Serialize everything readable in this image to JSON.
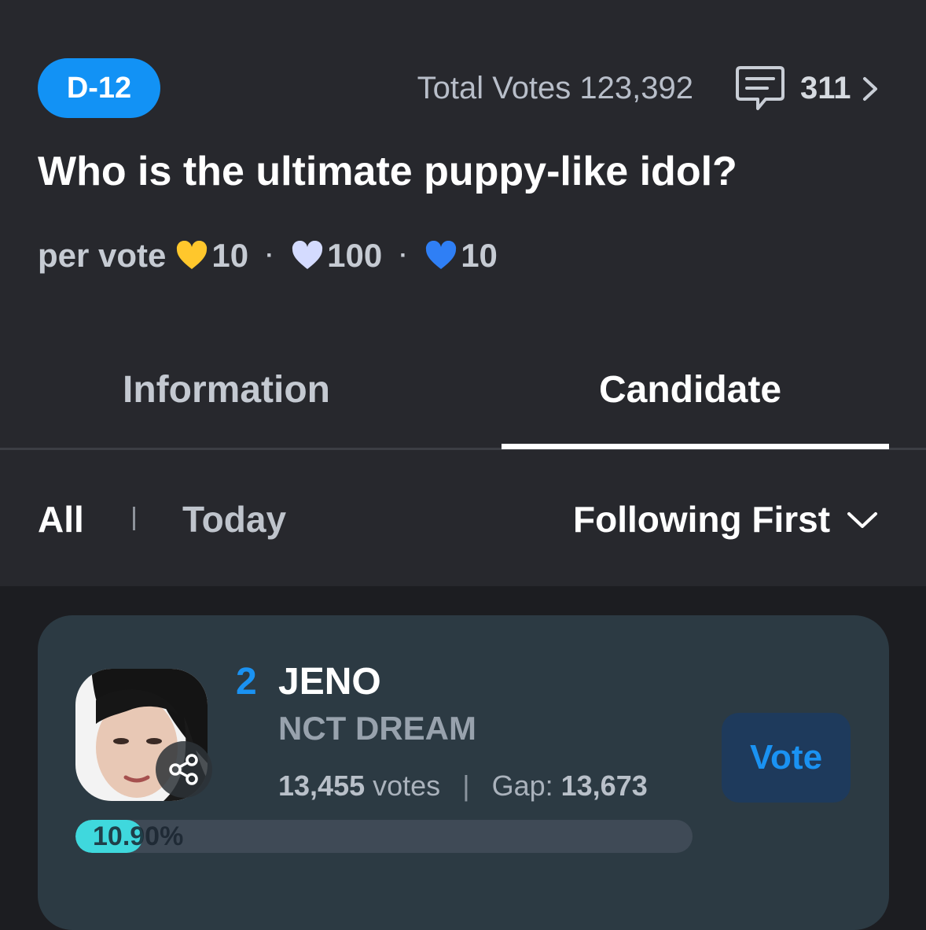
{
  "header": {
    "dday_badge": "D-12",
    "total_votes": "Total Votes 123,392",
    "comment_count": "311",
    "title": "Who is the ultimate puppy-like idol?"
  },
  "per_vote": {
    "label": "per vote",
    "costs": [
      {
        "icon": "gold-heart-icon",
        "color": "#ffc72c",
        "value": "10"
      },
      {
        "icon": "silver-heart-icon",
        "color": "#d4dbff",
        "value": "100"
      },
      {
        "icon": "blue-heart-icon",
        "color": "#2f7ff5",
        "value": "10"
      }
    ]
  },
  "tabs": [
    {
      "label": "Information",
      "active": false
    },
    {
      "label": "Candidate",
      "active": true
    }
  ],
  "filters": {
    "all": "All",
    "today": "Today",
    "sort": "Following First"
  },
  "candidate": {
    "rank": "2",
    "name": "JENO",
    "group": "NCT DREAM",
    "votes_num": "13,455",
    "votes_label": "votes",
    "separator": "|",
    "gap_label": "Gap:",
    "gap_num": "13,673",
    "vote_button": "Vote",
    "percent_text": "10.90%",
    "percent": 10.9
  },
  "colors": {
    "accent": "#1292f5",
    "progress": "#3fd8dd",
    "card": "#2c3a43"
  }
}
